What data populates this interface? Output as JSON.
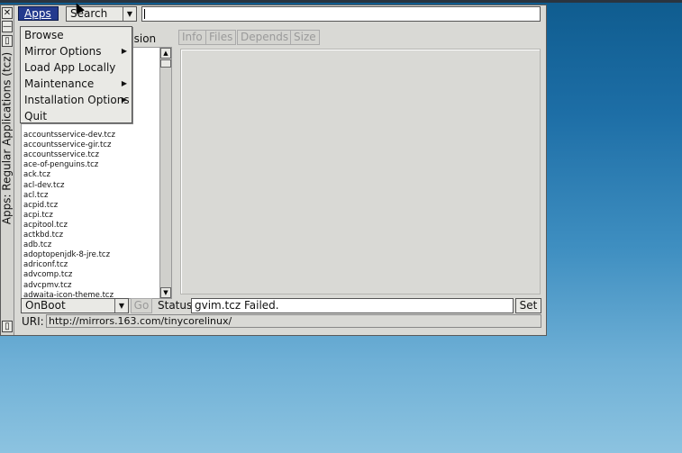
{
  "window": {
    "title": "Apps: Regular Applications (tcz)"
  },
  "titlebar_buttons": {
    "close": "✕",
    "minimize": "—",
    "maximize": "▯",
    "shade": "▯"
  },
  "toolbar": {
    "apps_label": "Apps",
    "search_mode": "Search",
    "search_value": ""
  },
  "menu": {
    "items": [
      {
        "label": "Browse",
        "submenu": false
      },
      {
        "label": "Mirror Options",
        "submenu": true
      },
      {
        "label": "Load App Locally",
        "submenu": false
      },
      {
        "label": "Maintenance",
        "submenu": true
      },
      {
        "label": "Installation Options",
        "submenu": true
      },
      {
        "label": "Quit",
        "submenu": false
      }
    ],
    "submenu_arrow": "▶"
  },
  "list": {
    "header_partial": "nsion",
    "items": [
      "accountsservice-dev.tcz",
      "accountsservice-gir.tcz",
      "accountsservice.tcz",
      "ace-of-penguins.tcz",
      "ack.tcz",
      "acl-dev.tcz",
      "acl.tcz",
      "acpid.tcz",
      "acpi.tcz",
      "acpitool.tcz",
      "actkbd.tcz",
      "adb.tcz",
      "adoptopenjdk-8-jre.tcz",
      "adriconf.tcz",
      "advcomp.tcz",
      "advcpmv.tcz",
      "adwaita-icon-theme.tcz"
    ]
  },
  "tabs": [
    "Info",
    "Files",
    "Depends",
    "Size"
  ],
  "bottom": {
    "onboot": "OnBoot",
    "go_label": "Go",
    "status_label": "Status",
    "status_value": "gvim.tcz Failed.",
    "set_label": "Set",
    "uri_label": "URI:",
    "uri_value": "http://mirrors.163.com/tinycorelinux/"
  },
  "icons": {
    "dropdown": "▼",
    "scroll_up": "▲",
    "scroll_down": "▼"
  }
}
